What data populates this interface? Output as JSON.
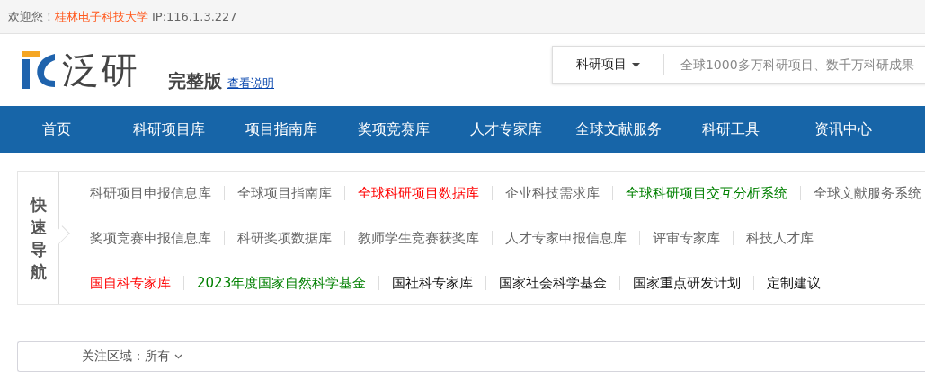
{
  "top_bar": {
    "greeting": "欢迎您！",
    "institution": "桂林电子科技大学",
    "ip": "IP:116.1.3.227"
  },
  "header": {
    "logo_text": "泛研",
    "edition": "完整版",
    "help_link": "查看说明",
    "search": {
      "category": "科研项目",
      "placeholder": "全球1000多万科研项目、数千万科研成果"
    }
  },
  "nav": [
    {
      "label": "首页"
    },
    {
      "label": "科研项目库"
    },
    {
      "label": "项目指南库"
    },
    {
      "label": "奖项竞赛库"
    },
    {
      "label": "人才专家库"
    },
    {
      "label": "全球文献服务"
    },
    {
      "label": "科研工具"
    },
    {
      "label": "资讯中心"
    }
  ],
  "quick_nav": {
    "title": "快速导航",
    "rows": [
      [
        {
          "label": "科研项目申报信息库",
          "color": "#666666"
        },
        {
          "label": "全球项目指南库",
          "color": "#666666"
        },
        {
          "label": "全球科研项目数据库",
          "color": "#ff0000"
        },
        {
          "label": "企业科技需求库",
          "color": "#666666"
        },
        {
          "label": "全球科研项目交互分析系统",
          "color": "#008000"
        },
        {
          "label": "全球文献服务系统",
          "color": "#666666"
        }
      ],
      [
        {
          "label": "奖项竞赛申报信息库",
          "color": "#666666"
        },
        {
          "label": "科研奖项数据库",
          "color": "#666666"
        },
        {
          "label": "教师学生竞赛获奖库",
          "color": "#666666"
        },
        {
          "label": "人才专家申报信息库",
          "color": "#666666"
        },
        {
          "label": "评审专家库",
          "color": "#666666"
        },
        {
          "label": "科技人才库",
          "color": "#666666"
        }
      ],
      [
        {
          "label": "国自科专家库",
          "color": "#ff0000"
        },
        {
          "label": "2023年度国家自然科学基金",
          "color": "#008000"
        },
        {
          "label": "国社科专家库",
          "color": "#111111"
        },
        {
          "label": "国家社会科学基金",
          "color": "#111111"
        },
        {
          "label": "国家重点研发计划",
          "color": "#111111"
        },
        {
          "label": "定制建议",
          "color": "#111111"
        }
      ]
    ]
  },
  "filter": {
    "label": "关注区域：所有"
  }
}
